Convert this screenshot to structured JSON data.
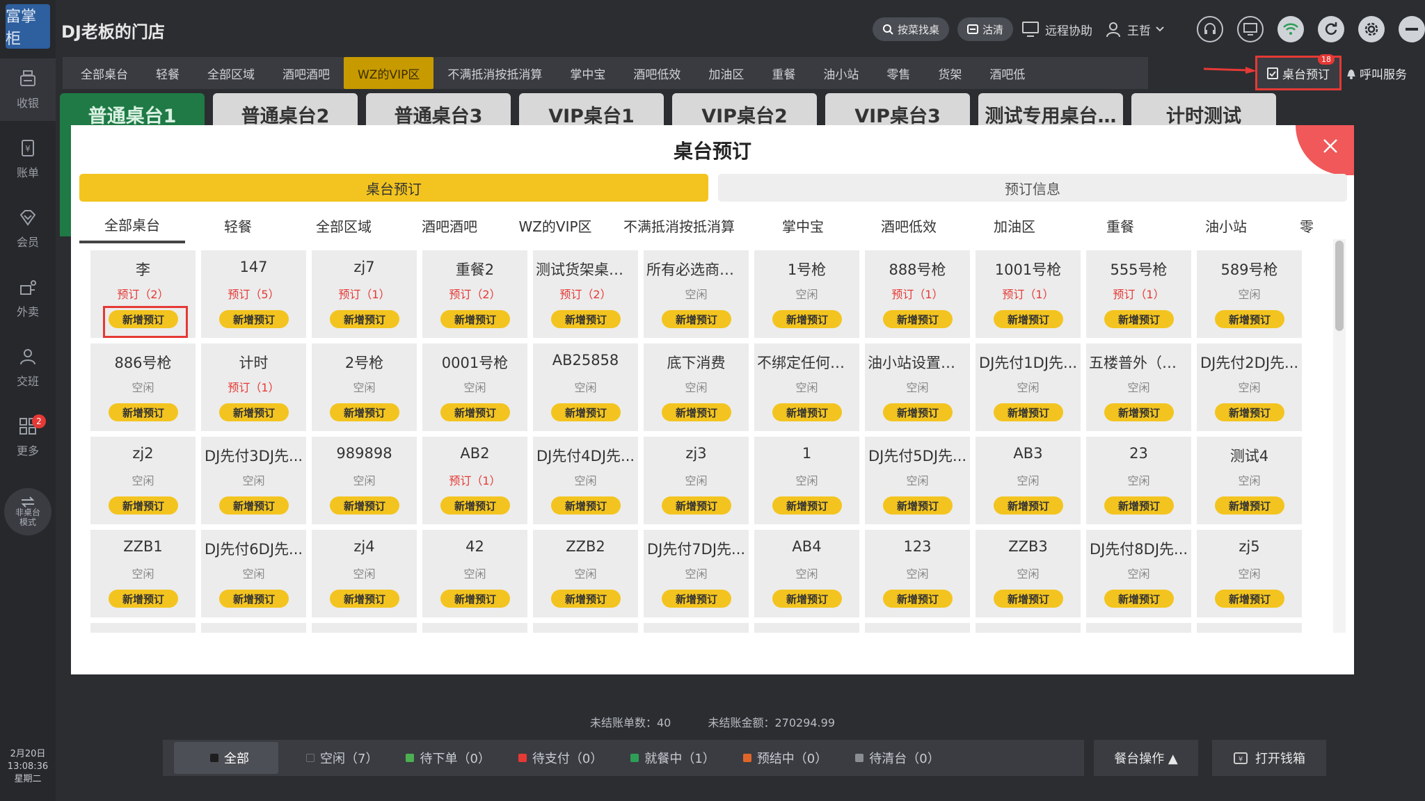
{
  "app": {
    "logo_text": "富掌柜",
    "store_name": "DJ老板的门店"
  },
  "topbar": {
    "search_label": "按菜找桌",
    "clean_label": "沽清",
    "remote_label": "远程协助",
    "user_name": "王哲"
  },
  "sidebar": {
    "items": [
      {
        "label": "收银",
        "icon": "cash-register-icon"
      },
      {
        "label": "账单",
        "icon": "bill-icon"
      },
      {
        "label": "会员",
        "icon": "member-icon"
      },
      {
        "label": "外卖",
        "icon": "takeout-icon"
      },
      {
        "label": "交班",
        "icon": "shift-icon"
      },
      {
        "label": "更多",
        "icon": "grid-icon",
        "badge": "2"
      }
    ],
    "mode_label": "非桌台模式",
    "date": "2月20日",
    "time": "13:08:36",
    "weekday": "星期二"
  },
  "area_tabs": [
    "全部桌台",
    "轻餐",
    "全部区域",
    "酒吧酒吧",
    "WZ的VIP区",
    "不满抵消按抵消算",
    "掌中宝",
    "酒吧低效",
    "加油区",
    "重餐",
    "油小站",
    "零售",
    "货架",
    "酒吧低"
  ],
  "area_tab_active": 4,
  "reserve_button": {
    "label": "桌台预订",
    "badge": "18"
  },
  "call_service_label": "呼叫服务",
  "sub_tabs": [
    "普通桌台1",
    "普通桌台2",
    "普通桌台3",
    "VIP桌台1",
    "VIP桌台2",
    "VIP桌台3",
    "测试专用桌台…",
    "计时测试"
  ],
  "modal": {
    "title": "桌台预订",
    "segments": [
      "桌台预订",
      "预订信息"
    ],
    "tabs": [
      "全部桌台",
      "轻餐",
      "全部区域",
      "酒吧酒吧",
      "WZ的VIP区",
      "不满抵消按抵消算",
      "掌中宝",
      "酒吧低效",
      "加油区",
      "重餐",
      "油小站",
      "零"
    ],
    "add_label": "新增预订",
    "tables": [
      {
        "name": "李",
        "status": "预订（2）",
        "reserved": true
      },
      {
        "name": "147",
        "status": "预订（5）",
        "reserved": true
      },
      {
        "name": "zj7",
        "status": "预订（1）",
        "reserved": true
      },
      {
        "name": "重餐2",
        "status": "预订（2）",
        "reserved": true
      },
      {
        "name": "测试货架桌台...",
        "status": "预订（2）",
        "reserved": true
      },
      {
        "name": "所有必选商品...",
        "status": "空闲",
        "reserved": false
      },
      {
        "name": "1号枪",
        "status": "空闲",
        "reserved": false
      },
      {
        "name": "888号枪",
        "status": "预订（1）",
        "reserved": true
      },
      {
        "name": "1001号枪",
        "status": "预订（1）",
        "reserved": true
      },
      {
        "name": "555号枪",
        "status": "预订（1）",
        "reserved": true
      },
      {
        "name": "589号枪",
        "status": "空闲",
        "reserved": false
      },
      {
        "name": "886号枪",
        "status": "空闲",
        "reserved": false
      },
      {
        "name": "计时",
        "status": "预订（1）",
        "reserved": true
      },
      {
        "name": "2号枪",
        "status": "空闲",
        "reserved": false
      },
      {
        "name": "0001号枪",
        "status": "空闲",
        "reserved": false
      },
      {
        "name": "AB25858",
        "status": "空闲",
        "reserved": false
      },
      {
        "name": "底下消费",
        "status": "空闲",
        "reserved": false
      },
      {
        "name": "不绑定任何必...",
        "status": "空闲",
        "reserved": false
      },
      {
        "name": "油小站设置了...",
        "status": "空闲",
        "reserved": false
      },
      {
        "name": "DJ先付1DJ先...",
        "status": "空闲",
        "reserved": false
      },
      {
        "name": "五楼普外（胸...",
        "status": "空闲",
        "reserved": false
      },
      {
        "name": "DJ先付2DJ先...",
        "status": "空闲",
        "reserved": false
      },
      {
        "name": "zj2",
        "status": "空闲",
        "reserved": false
      },
      {
        "name": "DJ先付3DJ先...",
        "status": "空闲",
        "reserved": false
      },
      {
        "name": "989898",
        "status": "空闲",
        "reserved": false
      },
      {
        "name": "AB2",
        "status": "预订（1）",
        "reserved": true
      },
      {
        "name": "DJ先付4DJ先...",
        "status": "空闲",
        "reserved": false
      },
      {
        "name": "zj3",
        "status": "空闲",
        "reserved": false
      },
      {
        "name": "1",
        "status": "空闲",
        "reserved": false
      },
      {
        "name": "DJ先付5DJ先...",
        "status": "空闲",
        "reserved": false
      },
      {
        "name": "AB3",
        "status": "空闲",
        "reserved": false
      },
      {
        "name": "23",
        "status": "空闲",
        "reserved": false
      },
      {
        "name": "测试4",
        "status": "空闲",
        "reserved": false
      },
      {
        "name": "ZZB1",
        "status": "空闲",
        "reserved": false
      },
      {
        "name": "DJ先付6DJ先...",
        "status": "空闲",
        "reserved": false
      },
      {
        "name": "zj4",
        "status": "空闲",
        "reserved": false
      },
      {
        "name": "42",
        "status": "空闲",
        "reserved": false
      },
      {
        "name": "ZZB2",
        "status": "空闲",
        "reserved": false
      },
      {
        "name": "DJ先付7DJ先...",
        "status": "空闲",
        "reserved": false
      },
      {
        "name": "AB4",
        "status": "空闲",
        "reserved": false
      },
      {
        "name": "123",
        "status": "空闲",
        "reserved": false
      },
      {
        "name": "ZZB3",
        "status": "空闲",
        "reserved": false
      },
      {
        "name": "DJ先付8DJ先...",
        "status": "空闲",
        "reserved": false
      },
      {
        "name": "zj5",
        "status": "空闲",
        "reserved": false
      }
    ]
  },
  "summary": {
    "unsettled_count": "未结账单数：40",
    "unsettled_amount": "未结账金额：270294.99"
  },
  "status_bar": [
    {
      "label": "全部",
      "color": "#1e1e1e"
    },
    {
      "label": "空闲（7）",
      "color": "transparent"
    },
    {
      "label": "待下单（0）",
      "color": "#4caf50"
    },
    {
      "label": "待支付（0）",
      "color": "#e53935"
    },
    {
      "label": "就餐中（1）",
      "color": "#2e9e57"
    },
    {
      "label": "预结中（0）",
      "color": "#e0652a"
    },
    {
      "label": "待清台（0）",
      "color": "#8a8d92"
    }
  ],
  "table_ops_label": "餐台操作 ▲",
  "drawer_label": "打开钱箱",
  "colors": {
    "accent_yellow": "#f3c41f",
    "active_green": "#1f7a45",
    "alert_red": "#e53935",
    "area_active": "#c79a00"
  }
}
